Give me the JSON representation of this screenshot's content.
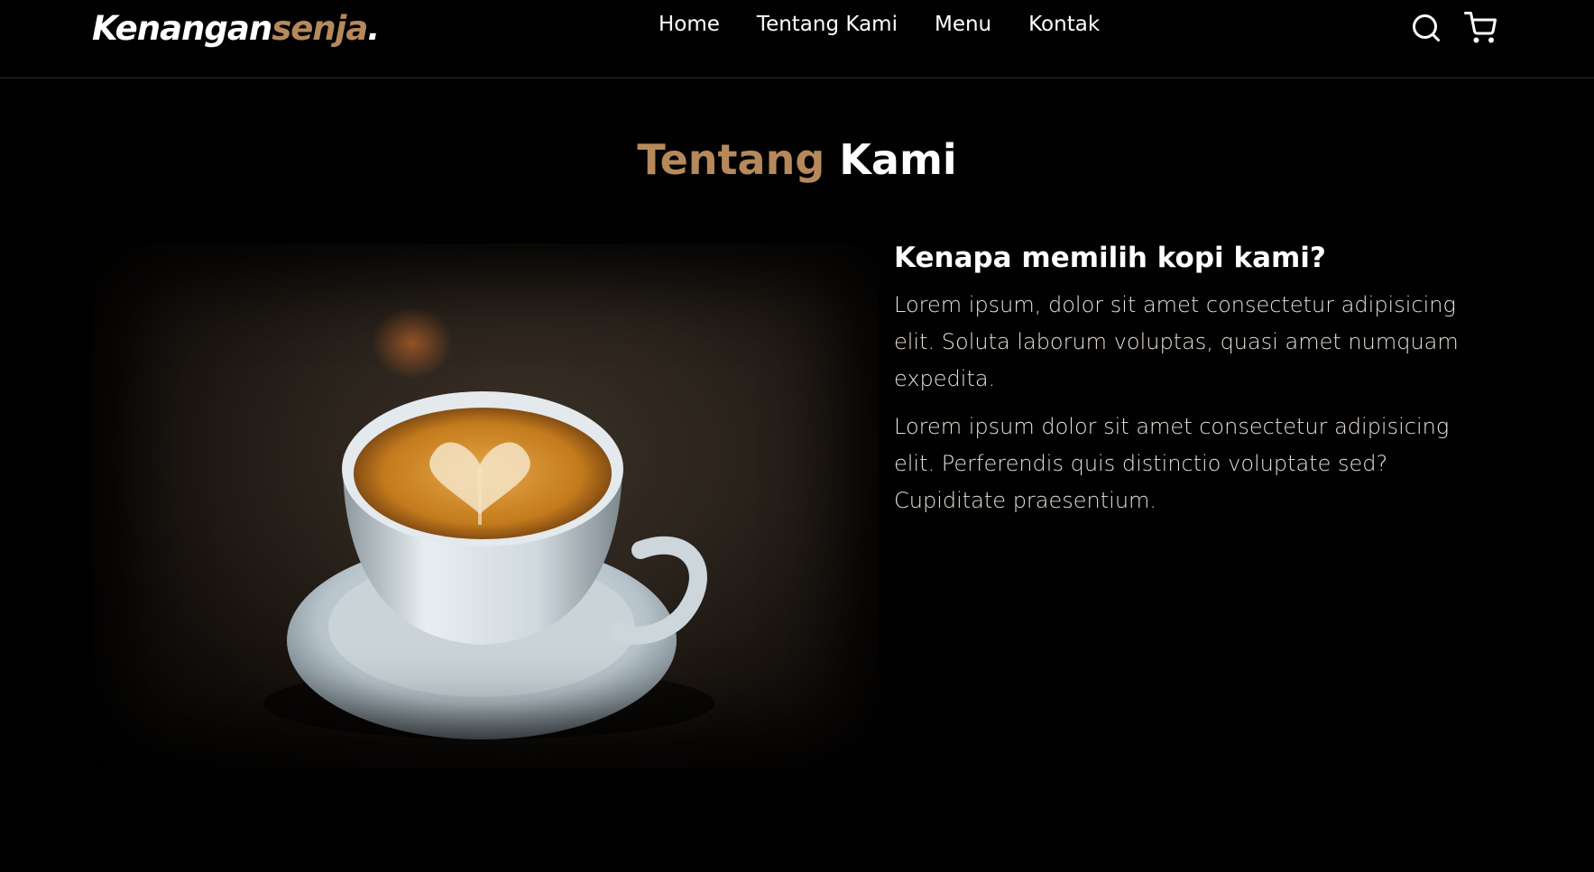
{
  "logo": {
    "part1": "Kenangan",
    "part2": "senja",
    "part3": "."
  },
  "nav": {
    "links": [
      "Home",
      "Tentang Kami",
      "Menu",
      "Kontak"
    ],
    "icons": [
      "search-icon",
      "cart-icon"
    ]
  },
  "section": {
    "title_accent": "Tentang",
    "title_rest": " Kami"
  },
  "about": {
    "heading": "Kenapa memilih kopi kami?",
    "paragraphs": [
      "Lorem ipsum, dolor sit amet consectetur adipisicing elit. Soluta laborum voluptas, quasi amet numquam expedita.",
      "Lorem ipsum dolor sit amet consectetur adipisicing elit. Perferendis quis distinctio voluptate sed? Cupiditate praesentium."
    ]
  },
  "colors": {
    "background": "#010101",
    "accent": "#b6895b",
    "text": "#ffffff"
  }
}
